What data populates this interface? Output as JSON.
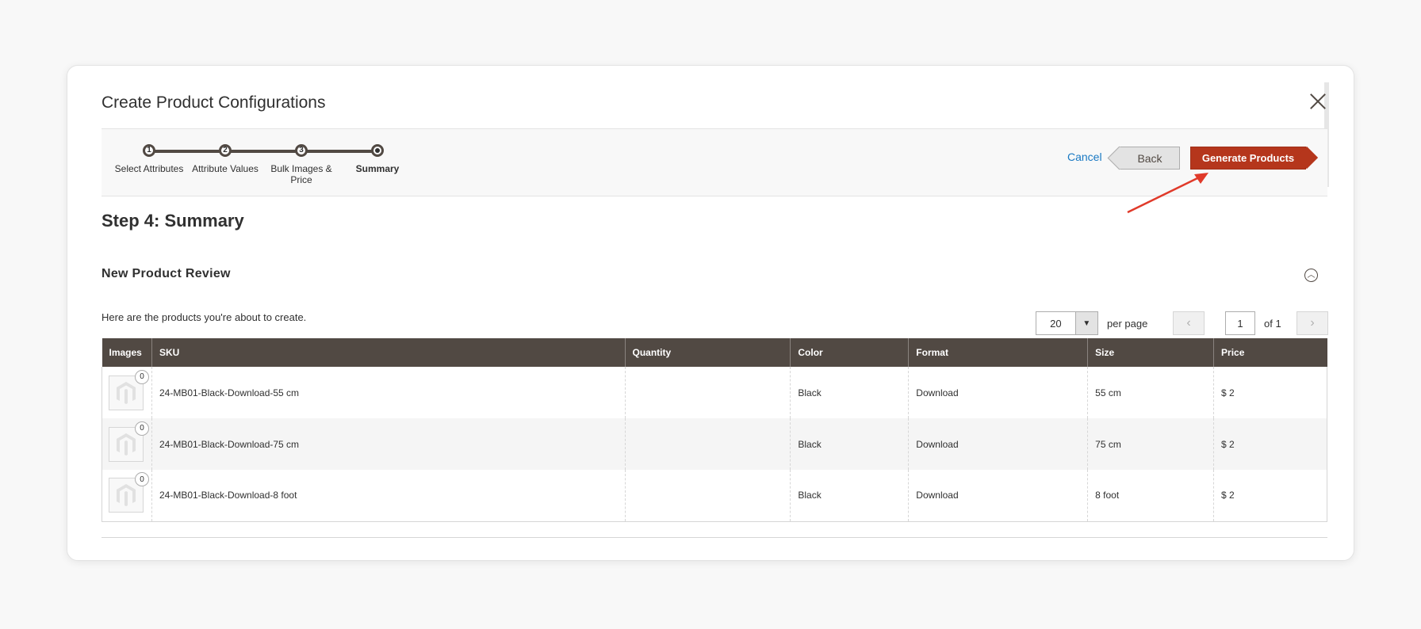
{
  "modal": {
    "title": "Create Product Configurations"
  },
  "wizard": {
    "steps": [
      {
        "number": "1",
        "label": "Select Attributes"
      },
      {
        "number": "2",
        "label": "Attribute Values"
      },
      {
        "number": "3",
        "label": "Bulk Images & Price"
      },
      {
        "number": "",
        "label": "Summary"
      }
    ],
    "cancel_label": "Cancel",
    "back_label": "Back",
    "generate_label": "Generate Products"
  },
  "main": {
    "step_title": "Step 4: Summary",
    "section_title": "New Product Review",
    "intro_text": "Here are the products you're about to create."
  },
  "pager": {
    "per_page_value": "20",
    "per_page_label": "per page",
    "current_page": "1",
    "of_label": "of 1"
  },
  "table": {
    "columns": [
      "Images",
      "SKU",
      "Quantity",
      "Color",
      "Format",
      "Size",
      "Price"
    ],
    "rows": [
      {
        "images_count": "0",
        "sku": "24-MB01-Black-Download-55 cm",
        "quantity": "",
        "color": "Black",
        "format": "Download",
        "size": "55 cm",
        "price": "$ 2"
      },
      {
        "images_count": "0",
        "sku": "24-MB01-Black-Download-75 cm",
        "quantity": "",
        "color": "Black",
        "format": "Download",
        "size": "75 cm",
        "price": "$ 2"
      },
      {
        "images_count": "0",
        "sku": "24-MB01-Black-Download-8 foot",
        "quantity": "",
        "color": "Black",
        "format": "Download",
        "size": "8 foot",
        "price": "$ 2"
      }
    ]
  },
  "colors": {
    "accent": "#b5361c",
    "link": "#1979c3",
    "header": "#514943",
    "annotation_arrow": "#e03a2a"
  }
}
